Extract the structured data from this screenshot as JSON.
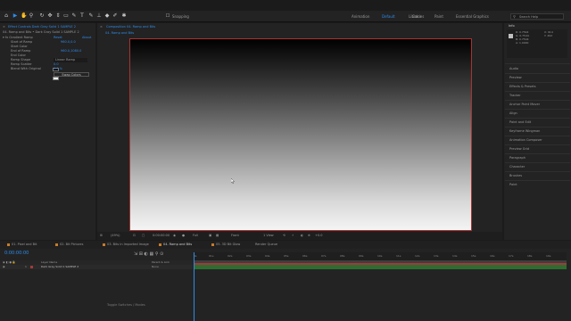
{
  "toolbar": {
    "snapping_label": "Snapping",
    "workspaces": [
      "Animation",
      "Default",
      "Libraries",
      "Color",
      "Paint",
      "Essential Graphics"
    ],
    "active_workspace": "Default",
    "search_placeholder": "Search Help"
  },
  "effect_controls": {
    "tab_label": "Effect Controls Dark Gray Solid 1 SAMPLE 2",
    "breadcrumb": "04. Ramp and Bits • Dark Gray Solid 1 SAMPLE 2",
    "effect_name": "Gradient Ramp",
    "reset_label": "Reset",
    "about_label": "About",
    "params": [
      {
        "name": "Start of Ramp",
        "value": "960.0,0.0"
      },
      {
        "name": "Start Color",
        "value": ""
      },
      {
        "name": "End of Ramp",
        "value": "960.0,1080.0"
      },
      {
        "name": "End Color",
        "value": ""
      },
      {
        "name": "Ramp Shape",
        "value": "Linear Ramp"
      },
      {
        "name": "Ramp Scatter",
        "value": "0.0"
      },
      {
        "name": "Blend With Original",
        "value": "0.0 %"
      }
    ],
    "swap_button": "Swap Colors"
  },
  "composition": {
    "tab_label": "Composition 04. Ramp and Bits",
    "breadcrumb": "04. Ramp and Bits",
    "viewer_bar": {
      "zoom": "(49%)",
      "timecode": "0:00:00:00",
      "resolution": "Full",
      "camera": "Front",
      "views": "1 View",
      "exposure": "+0.0"
    }
  },
  "right_panel": {
    "info_title": "Info",
    "info_lines": [
      "R: 0.7544",
      "G: 0.7544",
      "B: 0.7544",
      "A: 1.0000",
      "X: 914",
      "Y: 492"
    ],
    "items": [
      "Audio",
      "Preview",
      "Effects & Presets",
      "Tracker",
      "Anchor Point Mover",
      "Align",
      "Paint and Edit",
      "Keyframe Wingman",
      "Animation Composer",
      "Preview Grid",
      "Paragraph",
      "Character",
      "Brushes",
      "Paint"
    ]
  },
  "timeline": {
    "tabs": [
      "01. Pixel and Bit",
      "02. Bit Pictures",
      "03. Bits in Imported Image",
      "04. Ramp and Bits",
      "05. 3D Bit Glow",
      "Render Queue"
    ],
    "active_tab": "04. Ramp and Bits",
    "timecode": "0:00:00:00",
    "col_headers": [
      "Layer Name",
      "Parent & Link"
    ],
    "layer": {
      "num": "1",
      "name": "Dark Gray Solid 1 SAMPLE 2",
      "parent": "None"
    },
    "ruler_ticks": [
      "0s",
      "01s",
      "02s",
      "03s",
      "04s",
      "05s",
      "06s",
      "07s",
      "08s",
      "09s",
      "10s",
      "11s",
      "12s",
      "13s",
      "14s",
      "15s",
      "16s",
      "17s",
      "18s",
      "19s"
    ],
    "status": "Toggle Switches / Modes"
  },
  "colors": {
    "accent": "#2d8ceb",
    "layer_bar": "#2e6d2f",
    "canvas_border": "#a83232",
    "panel_bg": "#232323"
  }
}
